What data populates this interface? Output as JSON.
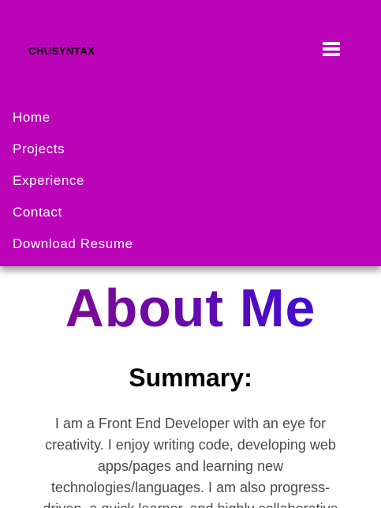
{
  "navbar": {
    "brand": "CHUSYNTAX",
    "menu_icon": "hamburger-menu-icon",
    "items": [
      {
        "label": "Home"
      },
      {
        "label": "Projects"
      },
      {
        "label": "Experience"
      },
      {
        "label": "Contact"
      },
      {
        "label": "Download Resume"
      }
    ],
    "background_color": "#bb04b8"
  },
  "about": {
    "title": "About Me",
    "title_gradient": [
      "#8a0a8a",
      "#2a10e6"
    ],
    "summary_heading": "Summary:",
    "summary_text": "I am a Front End Developer with an eye for creativity. I enjoy writing code, developing web apps/pages and learning new technologies/languages. I am also progress-driven, a quick learner, and highly collaborative"
  }
}
